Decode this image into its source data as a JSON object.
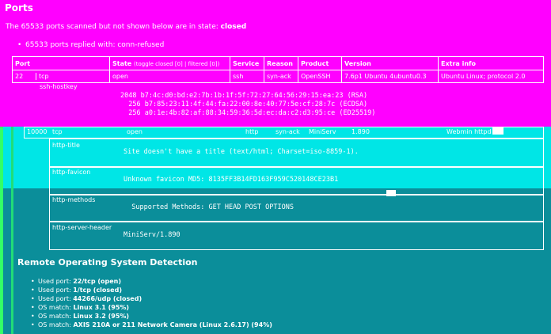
{
  "ports_section": {
    "title": "Ports",
    "summary_prefix": "The 65533 ports scanned but not shown below are in state:",
    "summary_state": "closed",
    "replied": "65533 ports replied with: conn-refused"
  },
  "table": {
    "headers": {
      "port": "Port",
      "state": "State",
      "state_toggle": "(toggle closed [0] | filtered [0])",
      "service": "Service",
      "reason": "Reason",
      "product": "Product",
      "version": "Version",
      "extra": "Extra info"
    },
    "row1": {
      "port": "22",
      "proto": "tcp",
      "state": "open",
      "service": "ssh",
      "reason": "syn-ack",
      "product": "OpenSSH",
      "version": "7.6p1 Ubuntu 4ubuntu0.3",
      "extra": "Ubuntu Linux; protocol 2.0"
    },
    "hostkey": {
      "label": "ssh-hostkey",
      "line1": "2048 b7:4c:d0:bd:e2:7b:1b:1f:5f:72:27:64:56:29:15:ea:23 (RSA)",
      "line2": "256 b7:85:23:11:4f:44:fa:22:00:8e:40:77:5e:cf:28:7c (ECDSA)",
      "line3": "256 a0:1e:4b:82:af:88:34:59:36:5d:ec:da:c2:d3:95:ce (ED25519)"
    },
    "row2": {
      "port": "10000",
      "proto": "tcp",
      "state": "open",
      "service": "http",
      "reason": "syn-ack",
      "product": "MiniServ",
      "version": "1.890",
      "extra": "Webmin httpd"
    },
    "scripts": [
      {
        "name": "http-title",
        "output": "Site doesn't have a title (text/html; Charset=iso-8859-1)."
      },
      {
        "name": "http-favicon",
        "output": "Unknown favicon MD5: 8135FF3B14FD163F959C520148CE23B1"
      },
      {
        "name": "http-methods",
        "output": "  Supported Methods: GET HEAD POST OPTIONS"
      },
      {
        "name": "http-server-header",
        "output": "MiniServ/1.890"
      }
    ]
  },
  "os_section": {
    "title": "Remote Operating System Detection",
    "items": [
      {
        "label": "Used port:",
        "value": "22/tcp (open)"
      },
      {
        "label": "Used port:",
        "value": "1/tcp (closed)"
      },
      {
        "label": "Used port:",
        "value": "44266/udp (closed)"
      },
      {
        "label": "OS match:",
        "value": "Linux 3.1 (95%)"
      },
      {
        "label": "OS match:",
        "value": "Linux 3.2 (95%)"
      },
      {
        "label": "OS match:",
        "value": "AXIS 210A or 211 Network Camera (Linux 2.6.17) (94%)"
      }
    ]
  }
}
